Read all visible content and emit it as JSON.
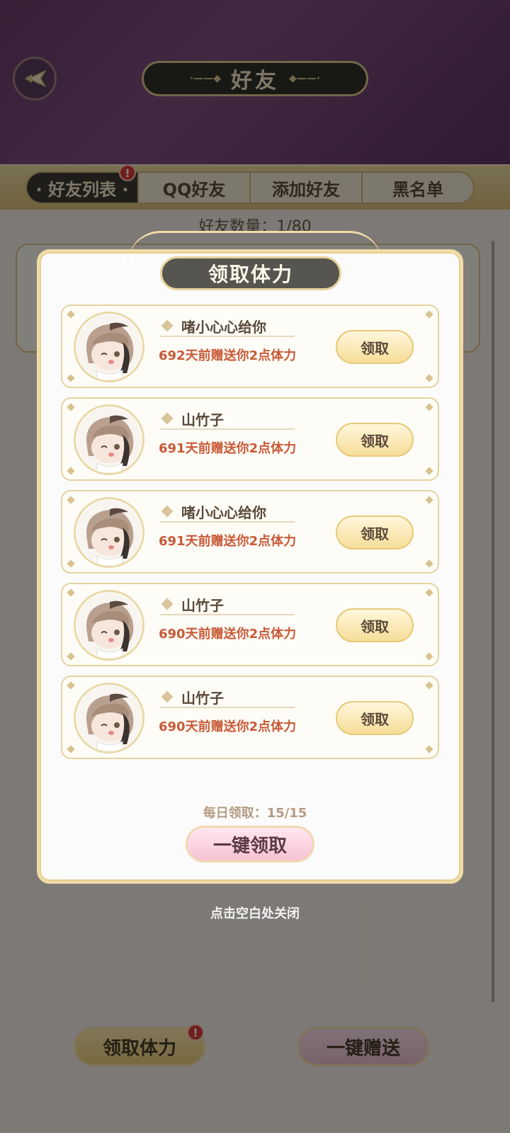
{
  "header": {
    "title": "好友"
  },
  "tabs": [
    {
      "label": "· 好友列表 ·",
      "active": true,
      "badge": "!"
    },
    {
      "label": "QQ好友"
    },
    {
      "label": "添加好友"
    },
    {
      "label": "黑名单"
    }
  ],
  "friend_count_text": "好友数量：1/80",
  "bottom": {
    "claim_stamina": "领取体力",
    "claim_badge": "!",
    "send_all": "一键赠送"
  },
  "modal": {
    "title": "领取体力",
    "rows": [
      {
        "name": "啫小心心给你",
        "gift_text": "692天前赠送你2点体力",
        "button": "领取"
      },
      {
        "name": "山竹子",
        "gift_text": "691天前赠送你2点体力",
        "button": "领取"
      },
      {
        "name": "啫小心心给你",
        "gift_text": "691天前赠送你2点体力",
        "button": "领取"
      },
      {
        "name": "山竹子",
        "gift_text": "690天前赠送你2点体力",
        "button": "领取"
      },
      {
        "name": "山竹子",
        "gift_text": "690天前赠送你2点体力",
        "button": "领取"
      }
    ],
    "daily_claim_text": "每日领取：15/15",
    "one_click_claim": "一键领取"
  },
  "close_hint": "点击空白处关闭",
  "colors": {
    "accent_gold": "#e8d39b",
    "gift_text": "#c85a38",
    "dark_plate": "#575550",
    "badge_red": "#d93a3a"
  }
}
